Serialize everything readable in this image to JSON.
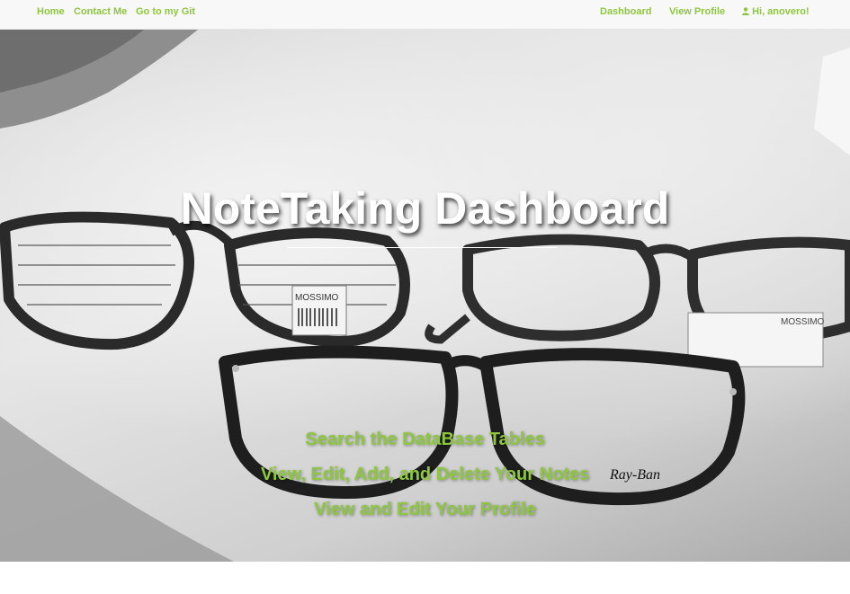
{
  "navbar": {
    "left_links": [
      "Home",
      "Contact Me",
      "Go to my Git"
    ],
    "right_links": [
      "Dashboard",
      "View Profile"
    ],
    "user_greeting": "Hi, anovero!",
    "user_icon": "user-icon",
    "link_color": "#8dc63f"
  },
  "hero": {
    "title": "NoteTaking Dashboard",
    "links": [
      "Search the DataBase Tables",
      "View, Edit, Add, and Delete Your Notes",
      "View and Edit Your Profile"
    ],
    "background_labels": {
      "tag_left": "MOSSIMO",
      "tag_right": "MOSSIMO",
      "brand": "Ray-Ban"
    }
  }
}
